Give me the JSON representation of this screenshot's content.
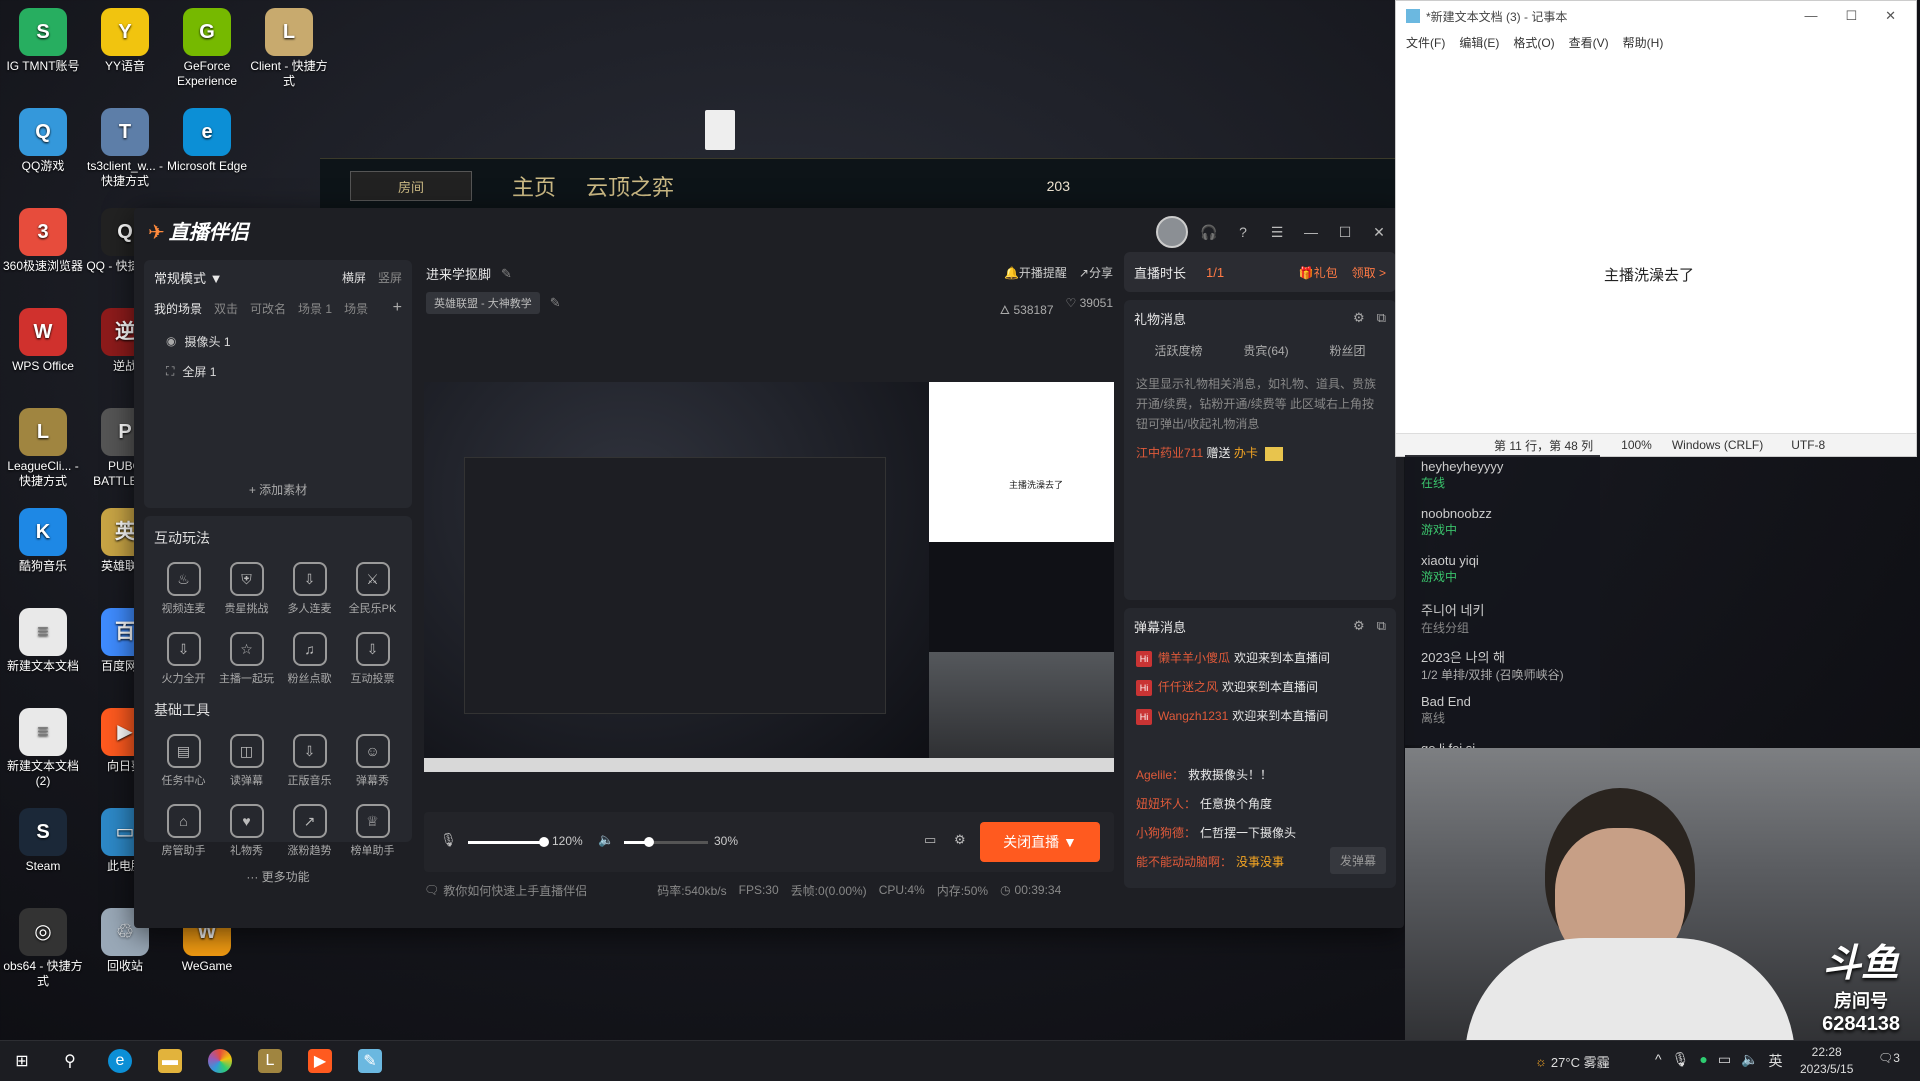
{
  "desktop": {
    "icons": [
      {
        "label": "IG TMNT账号",
        "color": "#27ae60",
        "glyph": "S"
      },
      {
        "label": "YY语音",
        "color": "#f1c40f",
        "glyph": "Y"
      },
      {
        "label": "GeForce Experience",
        "color": "#76b900",
        "glyph": "G"
      },
      {
        "label": "Client - 快捷方式",
        "color": "#c8aa6e",
        "glyph": "L"
      },
      {
        "label": "QQ游戏",
        "color": "#3498db",
        "glyph": "Q"
      },
      {
        "label": "ts3client_w... - 快捷方式",
        "color": "#5d7ea8",
        "glyph": "T"
      },
      {
        "label": "Microsoft Edge",
        "color": "#0c8fd6",
        "glyph": "e"
      },
      {
        "label": "360极速浏览器",
        "color": "#e74c3c",
        "glyph": "3"
      },
      {
        "label": "QQ - 快捷方式",
        "color": "#222222",
        "glyph": "Q"
      },
      {
        "label": "WPS Office",
        "color": "#d0312d",
        "glyph": "W"
      },
      {
        "label": "逆战",
        "color": "#8e1b1b",
        "glyph": "逆"
      },
      {
        "label": "LeagueCli... - 快捷方式",
        "color": "#a08540",
        "glyph": "L"
      },
      {
        "label": "PUBG BATTLEG...",
        "color": "#555555",
        "glyph": "P"
      },
      {
        "label": "酷狗音乐",
        "color": "#1e88e5",
        "glyph": "K"
      },
      {
        "label": "英雄联盟",
        "color": "#c9a545",
        "glyph": "英"
      },
      {
        "label": "新建文本文档",
        "color": "#e9e9e9",
        "glyph": "≡"
      },
      {
        "label": "百度网盘",
        "color": "#3f8cff",
        "glyph": "百"
      },
      {
        "label": "新建文本文档 (2)",
        "color": "#e9e9e9",
        "glyph": "≡"
      },
      {
        "label": "向日葵",
        "color": "#ff5a1f",
        "glyph": "▶"
      },
      {
        "label": "Steam",
        "color": "#1b2838",
        "glyph": "S"
      },
      {
        "label": "此电脑",
        "color": "#2d89c8",
        "glyph": "▭"
      },
      {
        "label": "obs64 - 快捷方式",
        "color": "#333333",
        "glyph": "◎"
      },
      {
        "label": "回收站",
        "color": "#9aa9b8",
        "glyph": "♲"
      },
      {
        "label": "WeGame",
        "color": "#f39c12",
        "glyph": "W"
      }
    ],
    "lol_nav": {
      "home": "主页",
      "tft": "云顶之弈",
      "room": "房间",
      "currency": "203"
    }
  },
  "app": {
    "logo": "直播伴侣",
    "left": {
      "mode": "常规模式 ▼",
      "orientation": {
        "landscape": "横屏",
        "portrait": "竖屏"
      },
      "scene_tabs": [
        "我的场景",
        "双击",
        "可改名",
        "场景 1",
        "场景"
      ],
      "scene_items": [
        {
          "icon": "camera-icon",
          "label": "摄像头 1"
        },
        {
          "icon": "fullscreen-icon",
          "label": "全屏 1"
        }
      ],
      "add_source": "+ 添加素材",
      "interactive_title": "互动玩法",
      "interactive": [
        "视频连麦",
        "贵星挑战",
        "多人连麦",
        "全民乐PK",
        "火力全开",
        "主播一起玩",
        "粉丝点歌",
        "互动投票"
      ],
      "tools_title": "基础工具",
      "tools": [
        "任务中心",
        "读弹幕",
        "正版音乐",
        "弹幕秀",
        "房管助手",
        "礼物秀",
        "涨粉趋势",
        "榜单助手"
      ],
      "more": "··· 更多功能"
    },
    "center": {
      "room_title": "进来学抠脚",
      "category": "英雄联盟 - 大神教学",
      "remind": "开播提醒",
      "share": "分享",
      "heat": "538187",
      "likes": "39051",
      "preview_note_text": "主播洗澡去了",
      "mic_volume_label": "120%",
      "mic_volume": 1.0,
      "speaker_volume_label": "30%",
      "speaker_volume": 0.3,
      "stop_live": "关闭直播 ▼",
      "tip": "教你如何快速上手直播伴侣",
      "stats": {
        "bitrate": "码率:540kb/s",
        "fps": "FPS:30",
        "drop": "丢帧:0(0.00%)",
        "cpu": "CPU:4%",
        "mem": "内存:50%",
        "duration": "00:39:34"
      }
    },
    "right": {
      "live_time_label": "直播时长",
      "page": "1/1",
      "gift_bag": "礼包",
      "claim": "领取 >",
      "gift_title": "礼物消息",
      "gift_tabs": [
        "活跃度榜",
        "贵宾(64)",
        "粉丝团"
      ],
      "gift_desc": "这里显示礼物相关消息，如礼物、道具、贵族开通/续费，钻粉开通/续费等 此区域右上角按钮可弹出/收起礼物消息",
      "gift_event": {
        "user": "江中药业711",
        "verb": "赠送",
        "item": "办卡"
      },
      "danmu_title": "弹幕消息",
      "welcomes": [
        {
          "user": "懒羊羊小傻瓜",
          "msg": "欢迎来到本直播间"
        },
        {
          "user": "仟仟迷之风",
          "msg": "欢迎来到本直播间"
        },
        {
          "user": "Wangzh1231",
          "msg": "欢迎来到本直播间"
        }
      ],
      "chats": [
        {
          "user": "Agelile：",
          "msg": "救救摄像头！！"
        },
        {
          "user": "妞妞坏人：",
          "msg": "任意换个角度"
        },
        {
          "user": "小狗狗德：",
          "msg": "仁哲摆一下摄像头"
        },
        {
          "user": "能不能动动脑啊：",
          "msg": "没事没事"
        }
      ],
      "send": "发弹幕"
    }
  },
  "notepad": {
    "title": "*新建文本文档 (3) - 记事本",
    "menu": [
      "文件(F)",
      "编辑(E)",
      "格式(O)",
      "查看(V)",
      "帮助(H)"
    ],
    "content": "主播洗澡去了",
    "status": {
      "position": "第 11 行，第 48 列",
      "zoom": "100%",
      "eol": "Windows (CRLF)",
      "encoding": "UTF-8"
    }
  },
  "friends": [
    {
      "name": "heyheyheyyyy",
      "status": "在线",
      "color": "#3ac26b"
    },
    {
      "name": "noobnoobzz",
      "status": "游戏中",
      "color": "#3ac26b"
    },
    {
      "name": "xiaotu yiqi",
      "status": "游戏中",
      "color": "#3ac26b"
    },
    {
      "name": "주니어 네키",
      "status": "在线分组",
      "color": "#888888"
    },
    {
      "name": "2023은 나의 해",
      "status": "1/2 单排/双排 (召唤师峡谷)",
      "color": "#aaaaaa"
    },
    {
      "name": "Bad End",
      "status": "离线",
      "color": "#888888"
    },
    {
      "name": "ge li fei si",
      "status": "",
      "color": "#888888"
    }
  ],
  "webcam": {
    "brand": "斗鱼",
    "room_label": "房间号",
    "room_no": "6284138"
  },
  "taskbar": {
    "weather": "27°C 雾霾",
    "ime": "英",
    "time": "22:28",
    "date": "2023/5/15",
    "notif": "3"
  }
}
